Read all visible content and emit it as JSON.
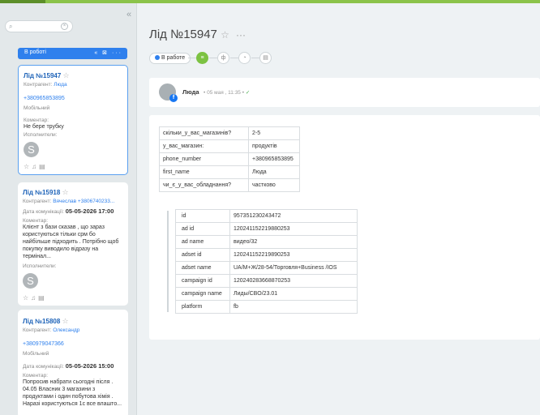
{
  "sidebar": {
    "search": {
      "placeholder": ""
    },
    "column": {
      "title": "В роботі"
    },
    "cards": [
      {
        "title": "Лід №15947",
        "counterparty_label": "Контрагент:",
        "counterparty": "Люда",
        "phone": "+380965853895",
        "phone_type": "Мобільний",
        "comment_label": "Коментар:",
        "comment": "Не бере трубку",
        "assignees_label": "Исполнители:",
        "avatar_letter": "S"
      },
      {
        "title": "Лід №15918",
        "counterparty_label": "Контрагент:",
        "counterparty": "Вячеслав +3806740233...",
        "date_label": "Дата комунікації:",
        "date": "05-05-2026 17:00",
        "comment_label": "Коментар:",
        "comment": "Клієнт з бази сказав , що зараз користуються тільки срм бо найбільше підходить . Потрібно щоб покупку виводило відразу на термінал...",
        "assignees_label": "Исполнители:",
        "avatar_letter": "S"
      },
      {
        "title": "Лід №15808",
        "counterparty_label": "Контрагент:",
        "counterparty": "Олександр",
        "phone": "+380979047366",
        "phone_type": "Мобільний",
        "date_label": "Дата комунікації:",
        "date": "05-05-2026 15:00",
        "comment_label": "Коментар:",
        "comment": "Попросив набрати сьогодні після . 04.05 Власник 3 магазини з продуктами і один побутова хімія . Наразі користуються 1с все влаштo..."
      }
    ]
  },
  "main": {
    "title": "Лід №15947",
    "status": "В работе",
    "message": {
      "author": "Люда",
      "time": "• 05 мая , 11:35 •"
    },
    "form_table": [
      [
        "скільки_у_вас_магазинів?",
        "2-5"
      ],
      [
        "у_вас_магазин:",
        "продуктів"
      ],
      [
        "phone_number",
        "+380965853895"
      ],
      [
        "first_name",
        "Люда"
      ],
      [
        "чи_є_у_вас_обладнання?",
        "частково"
      ]
    ],
    "ad_table": [
      [
        "id",
        "957351230243472"
      ],
      [
        "ad id",
        "120241152219880253"
      ],
      [
        "ad name",
        "видео/32"
      ],
      [
        "adset id",
        "120241152219890253"
      ],
      [
        "adset name",
        "UA/M+Ж/28-54/Торговля+Business /IOS"
      ],
      [
        "campaign id",
        "120240283668870253"
      ],
      [
        "campaign name",
        "Лиды/CBO/23.01"
      ],
      [
        "platform",
        "fb"
      ]
    ]
  },
  "colors": {
    "accent": "#2f80ed",
    "topbar": "#8bc34a",
    "active_step": "#7cc242",
    "facebook": "#1877f2"
  },
  "icons": [
    "collapse-icon",
    "search-icon",
    "clear-icon",
    "star-icon",
    "bell-icon",
    "note-icon",
    "facebook-icon",
    "check-icon"
  ]
}
